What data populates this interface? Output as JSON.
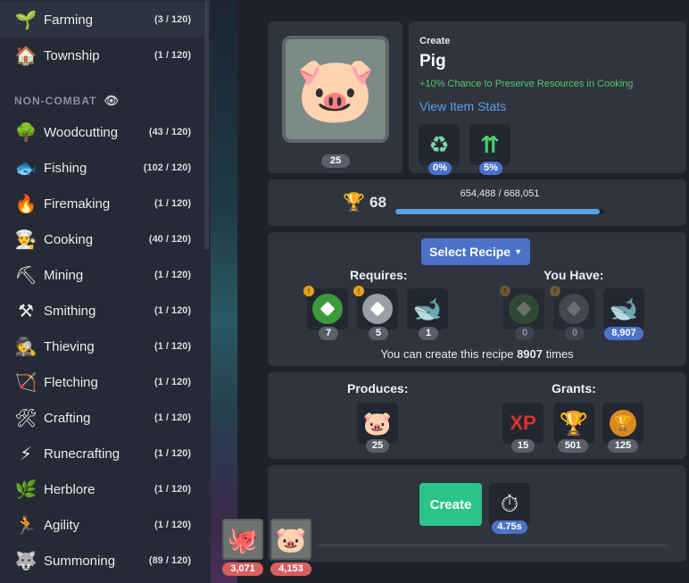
{
  "sidebar": {
    "items_top": [
      {
        "label": "Farming",
        "count": "(3 / 120)",
        "icon": "sprout-icon",
        "glyph": "🌱",
        "active": true
      },
      {
        "label": "Township",
        "count": "(1 / 120)",
        "icon": "house-icon",
        "glyph": "🏠",
        "active": false
      }
    ],
    "section_header": "NON-COMBAT",
    "items": [
      {
        "label": "Woodcutting",
        "count": "(43 / 120)",
        "icon": "tree-icon",
        "glyph": "🌳"
      },
      {
        "label": "Fishing",
        "count": "(102 / 120)",
        "icon": "fish-icon",
        "glyph": "🐟"
      },
      {
        "label": "Firemaking",
        "count": "(1 / 120)",
        "icon": "fire-icon",
        "glyph": "🔥"
      },
      {
        "label": "Cooking",
        "count": "(40 / 120)",
        "icon": "chef-hat-icon",
        "glyph": "👨‍🍳"
      },
      {
        "label": "Mining",
        "count": "(1 / 120)",
        "icon": "pickaxe-icon",
        "glyph": "⛏"
      },
      {
        "label": "Smithing",
        "count": "(1 / 120)",
        "icon": "anvil-icon",
        "glyph": "⚒"
      },
      {
        "label": "Thieving",
        "count": "(1 / 120)",
        "icon": "thief-icon",
        "glyph": "🕵"
      },
      {
        "label": "Fletching",
        "count": "(1 / 120)",
        "icon": "bow-arrow-icon",
        "glyph": "🏹"
      },
      {
        "label": "Crafting",
        "count": "(1 / 120)",
        "icon": "tools-icon",
        "glyph": "🛠"
      },
      {
        "label": "Runecrafting",
        "count": "(1 / 120)",
        "icon": "rune-icon",
        "glyph": "⚡"
      },
      {
        "label": "Herblore",
        "count": "(1 / 120)",
        "icon": "leaf-icon",
        "glyph": "🌿"
      },
      {
        "label": "Agility",
        "count": "(1 / 120)",
        "icon": "runner-icon",
        "glyph": "🏃"
      },
      {
        "label": "Summoning",
        "count": "(89 / 120)",
        "icon": "wolf-icon",
        "glyph": "🐺"
      }
    ]
  },
  "item": {
    "create_label": "Create",
    "name": "Pig",
    "bonus": "+10% Chance to Preserve Resources in Cooking",
    "view_stats": "View Item Stats",
    "quantity": "25",
    "preserve_pct": "0%",
    "double_pct": "5%"
  },
  "mastery": {
    "level": "68",
    "xp_text": "654,488 / 668,051",
    "progress": 0.98
  },
  "recipe": {
    "select_label": "Select Recipe",
    "requires_label": "Requires:",
    "have_label": "You Have:",
    "requires": [
      "7",
      "5",
      "1"
    ],
    "have": [
      "0",
      "0",
      "8,907"
    ],
    "can_create_prefix": "You can create this recipe",
    "can_create_count": "8907",
    "can_create_suffix": "times"
  },
  "output": {
    "produces_label": "Produces:",
    "grants_label": "Grants:",
    "produces_qty": "25",
    "xp_label": "XP",
    "grants": [
      "15",
      "501",
      "125"
    ]
  },
  "action": {
    "create_button": "Create",
    "time": "4.75s"
  },
  "summons": [
    {
      "qty": "3,071",
      "icon": "octopus-icon",
      "glyph": "🐙"
    },
    {
      "qty": "4,153",
      "icon": "pig-icon",
      "glyph": "🐷"
    }
  ],
  "colors": {
    "accent_blue": "#4a72c8",
    "create_green": "#2bc48a",
    "bonus_green": "#4cc96b",
    "link_blue": "#5b9fe6"
  }
}
